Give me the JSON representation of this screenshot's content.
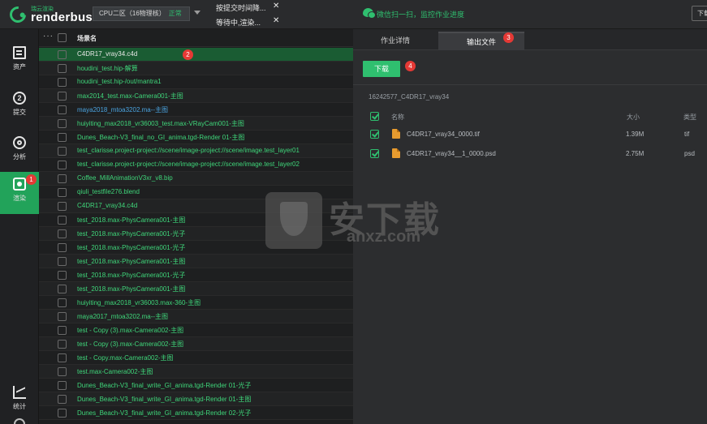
{
  "app": {
    "logo_cn": "瑞云渲染",
    "logo_text": "renderbus",
    "region_label": "CPU二区（16物理核）",
    "region_status": "正常",
    "notifications": [
      {
        "text": "按提交时间降..."
      },
      {
        "text": "等待中,渲染..."
      }
    ],
    "wechat_text": "微信扫一扫，监控作业进度",
    "top_right_button": "下载"
  },
  "sidebar": {
    "items": [
      {
        "label": "资产",
        "icon": "document-icon"
      },
      {
        "label": "提交",
        "icon": "submit-icon"
      },
      {
        "label": "分析",
        "icon": "analyze-icon"
      },
      {
        "label": "渲染",
        "icon": "render-icon",
        "active": true,
        "badge": "1"
      },
      {
        "label": "统计",
        "icon": "stats-icon"
      }
    ]
  },
  "job_list": {
    "header": "场景名",
    "selected_badge": "2",
    "rows": [
      {
        "name": "C4DR17_vray34.c4d",
        "style": "white",
        "selected": true
      },
      {
        "name": "houdini_test.hip-解算",
        "style": "green"
      },
      {
        "name": "houdini_test.hip-/out/mantra1",
        "style": "green"
      },
      {
        "name": "max2014_test.max-Camera001-主图",
        "style": "green"
      },
      {
        "name": "maya2018_mtoa3202.ma--主图",
        "style": "blue"
      },
      {
        "name": "huiyiting_max2018_vr36003_test.max-VRayCam001-主图",
        "style": "green"
      },
      {
        "name": "Dunes_Beach-V3_final_no_GI_anima.tgd-Render 01-主图",
        "style": "green"
      },
      {
        "name": "test_clarisse.project-project://scene/image-project://scene/image.test_layer01",
        "style": "green"
      },
      {
        "name": "test_clarisse.project-project://scene/image-project://scene/image.test_layer02",
        "style": "green"
      },
      {
        "name": "Coffee_MillAnimationV3xr_v8.bip",
        "style": "green"
      },
      {
        "name": "qiuli_testfile276.blend",
        "style": "green"
      },
      {
        "name": "C4DR17_vray34.c4d",
        "style": "green"
      },
      {
        "name": "test_2018.max-PhysCamera001-主图",
        "style": "green"
      },
      {
        "name": "test_2018.max-PhysCamera001-光子",
        "style": "green"
      },
      {
        "name": "test_2018.max-PhysCamera001-光子",
        "style": "green"
      },
      {
        "name": "test_2018.max-PhysCamera001-主图",
        "style": "green"
      },
      {
        "name": "test_2018.max-PhysCamera001-光子",
        "style": "green"
      },
      {
        "name": "test_2018.max-PhysCamera001-主图",
        "style": "green"
      },
      {
        "name": "huiyiting_max2018_vr36003.max-360-主图",
        "style": "green"
      },
      {
        "name": "maya2017_mtoa3202.ma--主图",
        "style": "green"
      },
      {
        "name": "test - Copy (3).max-Camera002-主图",
        "style": "green"
      },
      {
        "name": "test - Copy (3).max-Camera002-主图",
        "style": "green"
      },
      {
        "name": "test - Copy.max-Camera002-主图",
        "style": "green"
      },
      {
        "name": "test.max-Camera002-主图",
        "style": "green"
      },
      {
        "name": "Dunes_Beach-V3_final_write_GI_anima.tgd-Render 01-光子",
        "style": "green"
      },
      {
        "name": "Dunes_Beach-V3_final_write_GI_anima.tgd-Render 01-主图",
        "style": "green"
      },
      {
        "name": "Dunes_Beach-V3_final_write_GI_anima.tgd-Render 02-光子",
        "style": "green"
      }
    ]
  },
  "detail": {
    "tabs": [
      {
        "label": "作业详情",
        "active": false
      },
      {
        "label": "输出文件",
        "active": true,
        "badge": "3"
      }
    ],
    "download_button": "下载",
    "download_badge": "4",
    "job_id": "16242577_C4DR17_vray34",
    "columns": {
      "name": "名称",
      "size": "大小",
      "type": "类型"
    },
    "files": [
      {
        "name": "C4DR17_vray34_0000.tif",
        "size": "1.39M",
        "type": "tif",
        "checked": true
      },
      {
        "name": "C4DR17_vray34__1_0000.psd",
        "size": "2.75M",
        "type": "psd",
        "checked": true
      }
    ]
  },
  "watermark": {
    "cn": "安下载",
    "en": "anxz.com"
  },
  "colors": {
    "accent": "#2fbf6f",
    "selected_row": "#1a5c33",
    "badge": "#e53935",
    "file_icon": "#e79b2f"
  }
}
